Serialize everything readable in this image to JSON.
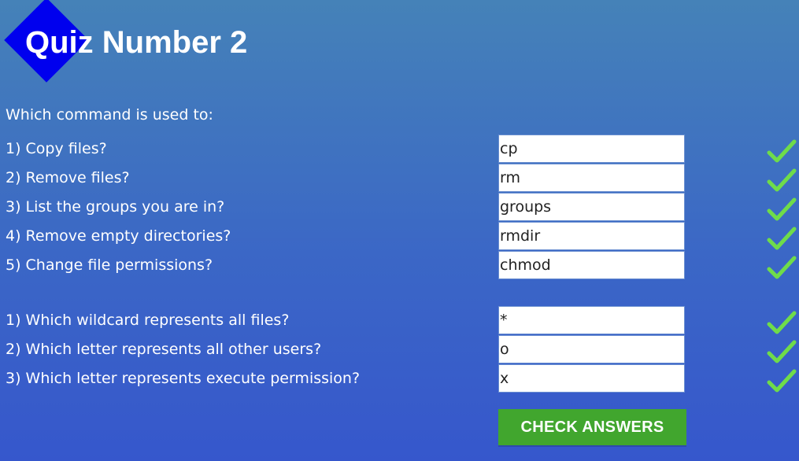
{
  "header": {
    "title": "Quiz Number 2"
  },
  "intro": "Which command is used to:",
  "section1": [
    {
      "label": "1) Copy files?",
      "answer": "cp"
    },
    {
      "label": "2) Remove files?",
      "answer": "rm"
    },
    {
      "label": "3) List the groups you are in?",
      "answer": "groups"
    },
    {
      "label": "4) Remove empty directories?",
      "answer": "rmdir"
    },
    {
      "label": "5) Change file permissions?",
      "answer": "chmod"
    }
  ],
  "section2": [
    {
      "label": "1) Which wildcard represents all files?",
      "answer": "*"
    },
    {
      "label": "2) Which letter represents all other users?",
      "answer": "o"
    },
    {
      "label": "3) Which letter represents execute permission?",
      "answer": "x"
    }
  ],
  "submit_label": "CHECK ANSWERS",
  "icons": {
    "logo": "blue-diamond-icon",
    "correct": "checkmark-icon"
  },
  "colors": {
    "diamond": "#0000ee",
    "check": "#6fdc4a",
    "button": "#41a62e",
    "background_top": "#4582b8",
    "background_bottom": "#3657cc"
  }
}
